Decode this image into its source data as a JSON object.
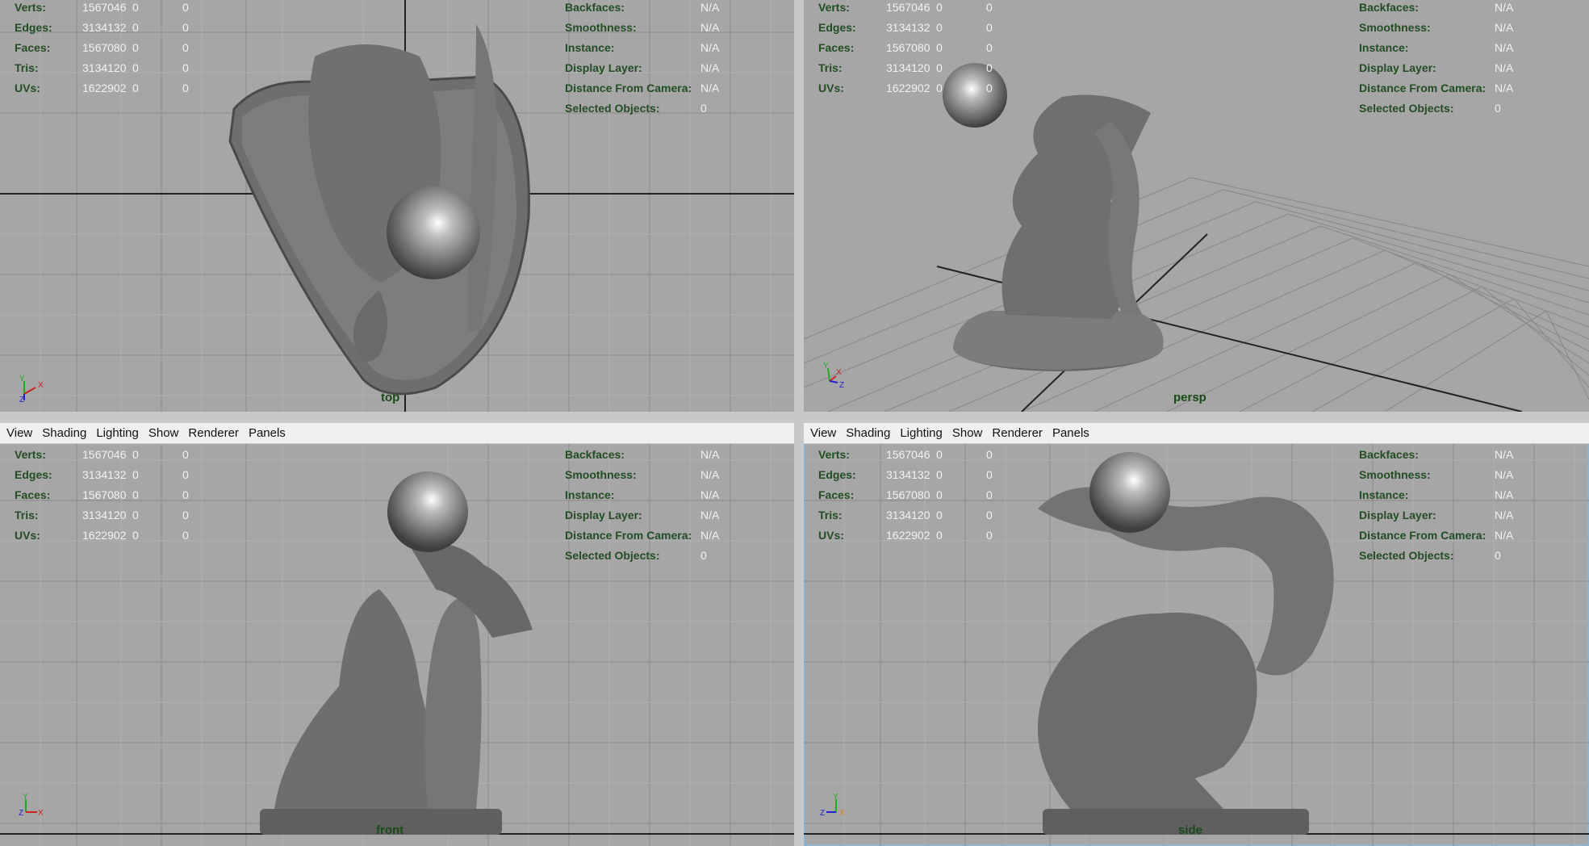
{
  "menu": [
    "View",
    "Shading",
    "Lighting",
    "Show",
    "Renderer",
    "Panels"
  ],
  "hud_left": [
    {
      "label": "Verts:",
      "v1": "1567046",
      "v2": "0",
      "v3": "0"
    },
    {
      "label": "Edges:",
      "v1": "3134132",
      "v2": "0",
      "v3": "0"
    },
    {
      "label": "Faces:",
      "v1": "1567080",
      "v2": "0",
      "v3": "0"
    },
    {
      "label": "Tris:",
      "v1": "3134120",
      "v2": "0",
      "v3": "0"
    },
    {
      "label": "UVs:",
      "v1": "1622902",
      "v2": "0",
      "v3": "0"
    }
  ],
  "hud_right": [
    {
      "label": "Backfaces:",
      "value": "N/A"
    },
    {
      "label": "Smoothness:",
      "value": "N/A"
    },
    {
      "label": "Instance:",
      "value": "N/A"
    },
    {
      "label": "Display Layer:",
      "value": "N/A"
    },
    {
      "label": "Distance From Camera:",
      "value": "N/A"
    },
    {
      "label": "Selected Objects:",
      "value": "0"
    }
  ],
  "viewports": {
    "top": {
      "camera": "top",
      "axes": [
        "Y",
        "X",
        "Z"
      ]
    },
    "persp": {
      "camera": "persp",
      "axes": [
        "Y",
        "X",
        "Z"
      ]
    },
    "front": {
      "camera": "front",
      "axes": [
        "Y",
        "Z",
        "X"
      ]
    },
    "side": {
      "camera": "side",
      "axes": [
        "Y",
        "Z",
        "X"
      ]
    }
  },
  "colors": {
    "viewport_bg": "#a6a6a6",
    "hud_label": "#234d23",
    "hud_value": "#f2f2f2",
    "active_border": "#8fb2cf"
  }
}
